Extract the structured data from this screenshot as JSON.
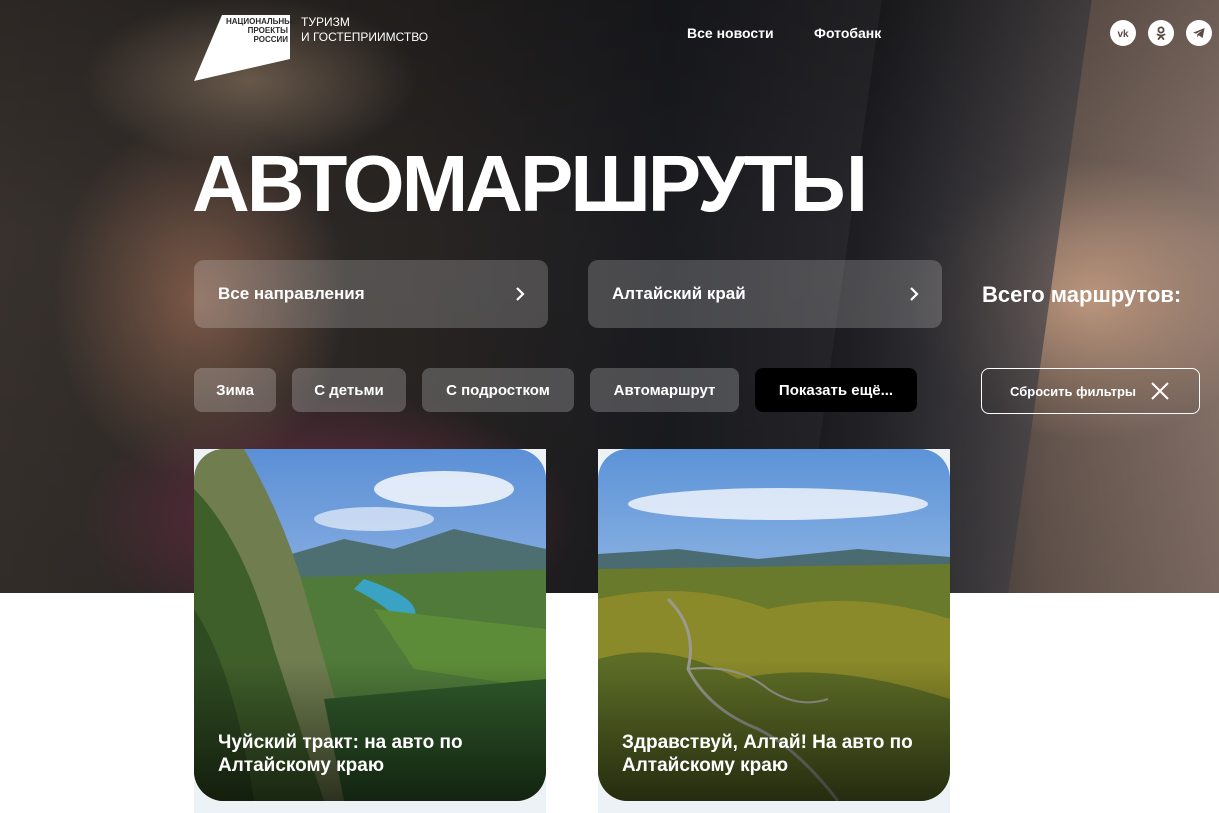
{
  "header": {
    "logo_text": [
      "НАЦИОНАЛЬНЫЕ",
      "ПРОЕКТЫ",
      "РОССИИ"
    ],
    "brand_line1": "ТУРИЗМ",
    "brand_line2": "И ГОСТЕПРИИМСТВО",
    "nav": [
      {
        "label": "Все новости"
      },
      {
        "label": "Фотобанк"
      }
    ],
    "social": [
      {
        "icon": "vk-icon"
      },
      {
        "icon": "odnoklassniki-icon"
      },
      {
        "icon": "telegram-icon"
      }
    ]
  },
  "hero": {
    "title": "АВТОМАРШРУТЫ",
    "filters": {
      "direction": "Все направления",
      "region": "Алтайский край"
    },
    "total_label": "Всего маршрутов:",
    "chips": [
      "Зима",
      "С детьми",
      "С подростком",
      "Автомаршрут",
      "Показать ещё..."
    ],
    "reset_label": "Сбросить фильтры"
  },
  "cards": [
    {
      "title": "Чуйский тракт: на авто по Алтайскому краю"
    },
    {
      "title": "Здравствуй, Алтай! На авто по Алтайскому краю"
    }
  ],
  "colors": {
    "text_on_dark": "#ffffff",
    "chip_dark": "#000000",
    "card_base": "#edf2f7"
  }
}
